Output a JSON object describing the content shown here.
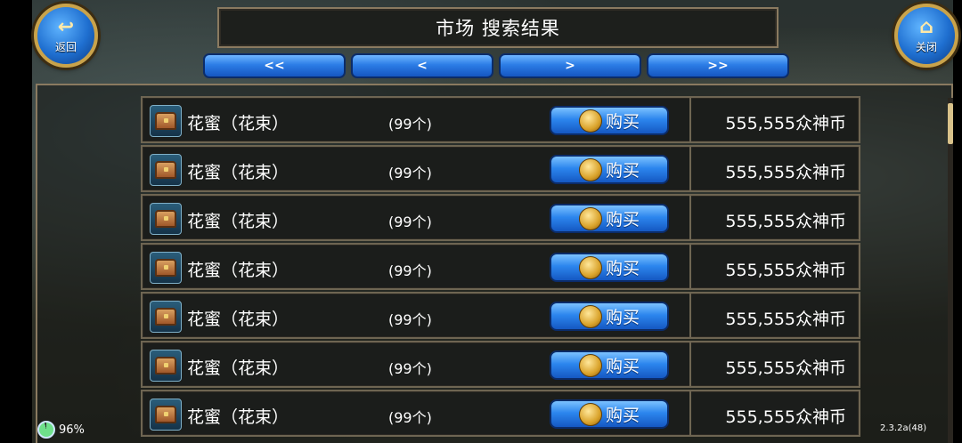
{
  "header": {
    "title": "市场 搜索结果",
    "back_label": "返回",
    "close_label": "关闭"
  },
  "pager": {
    "first": "<<",
    "prev": "<",
    "next": ">",
    "last": ">>"
  },
  "listings": [
    {
      "name": "花蜜（花束）",
      "quantity": "(99个)",
      "buy_label": "购买",
      "price": "555,555众神币"
    },
    {
      "name": "花蜜（花束）",
      "quantity": "(99个)",
      "buy_label": "购买",
      "price": "555,555众神币"
    },
    {
      "name": "花蜜（花束）",
      "quantity": "(99个)",
      "buy_label": "购买",
      "price": "555,555众神币"
    },
    {
      "name": "花蜜（花束）",
      "quantity": "(99个)",
      "buy_label": "购买",
      "price": "555,555众神币"
    },
    {
      "name": "花蜜（花束）",
      "quantity": "(99个)",
      "buy_label": "购买",
      "price": "555,555众神币"
    },
    {
      "name": "花蜜（花束）",
      "quantity": "(99个)",
      "buy_label": "购买",
      "price": "555,555众神币"
    },
    {
      "name": "花蜜（花束）",
      "quantity": "(99个)",
      "buy_label": "购买",
      "price": "555,555众神币"
    }
  ],
  "status": {
    "battery": "96%",
    "version": "2.3.2a(48)"
  },
  "icons": {
    "back": "back-arrow-icon",
    "close": "home-icon",
    "item": "treasure-chest-icon",
    "buy": "coin-icon"
  },
  "colors": {
    "button_blue": "#2c7de6",
    "frame_gold": "#c9a34b",
    "panel_border": "#6e6552"
  }
}
